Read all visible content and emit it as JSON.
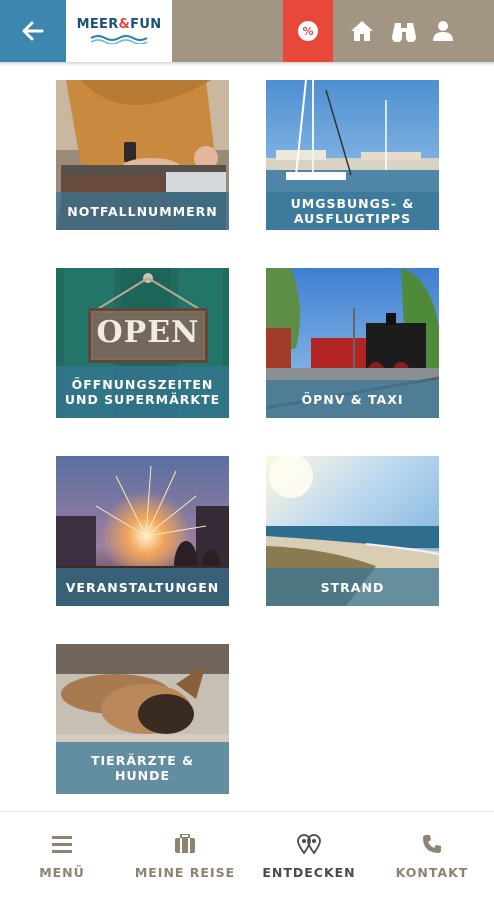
{
  "header": {
    "logo_text_left": "MEER",
    "logo_amp": "&",
    "logo_text_right": "FUN",
    "promo_symbol": "%",
    "icons": [
      "back-arrow-icon",
      "percent-icon",
      "home-icon",
      "binoculars-icon",
      "user-icon"
    ],
    "colors": {
      "back": "#3d86ad",
      "bar": "#a39583",
      "promo": "#e8483a"
    }
  },
  "tiles": [
    {
      "label": "NOTFALLNUMMERN"
    },
    {
      "label": "UMGSBUNGS- &\nAUSFLUGTIPPS"
    },
    {
      "label": "ÖFFNUNGSZEITEN\nUND SUPERMÄRKTE"
    },
    {
      "label": "ÖPNV & TAXI"
    },
    {
      "label": "VERANSTALTUNGEN"
    },
    {
      "label": "STRAND"
    },
    {
      "label": "TIERÄRZTE &\nHUNDE"
    }
  ],
  "sign_text": "OPEN",
  "bottom_nav": {
    "items": [
      {
        "label": "MENÜ",
        "icon": "menu-icon"
      },
      {
        "label": "MEINE REISE",
        "icon": "suitcase-icon"
      },
      {
        "label": "ENTDECKEN",
        "icon": "map-pins-icon",
        "active": true
      },
      {
        "label": "KONTAKT",
        "icon": "phone-icon"
      }
    ]
  }
}
